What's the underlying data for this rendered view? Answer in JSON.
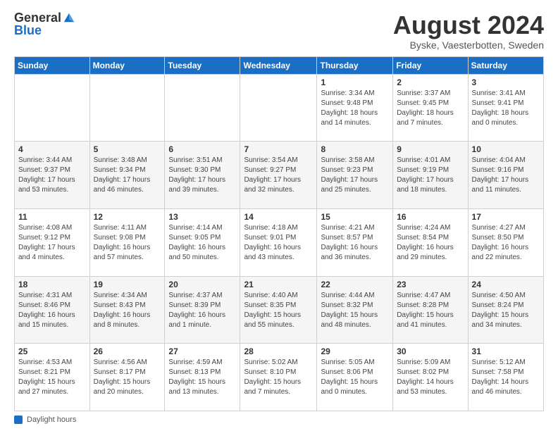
{
  "logo": {
    "general": "General",
    "blue": "Blue"
  },
  "title": "August 2024",
  "subtitle": "Byske, Vaesterbotten, Sweden",
  "days_of_week": [
    "Sunday",
    "Monday",
    "Tuesday",
    "Wednesday",
    "Thursday",
    "Friday",
    "Saturday"
  ],
  "footer": {
    "daylight_label": "Daylight hours"
  },
  "weeks": [
    [
      {
        "day": "",
        "info": ""
      },
      {
        "day": "",
        "info": ""
      },
      {
        "day": "",
        "info": ""
      },
      {
        "day": "",
        "info": ""
      },
      {
        "day": "1",
        "info": "Sunrise: 3:34 AM\nSunset: 9:48 PM\nDaylight: 18 hours\nand 14 minutes."
      },
      {
        "day": "2",
        "info": "Sunrise: 3:37 AM\nSunset: 9:45 PM\nDaylight: 18 hours\nand 7 minutes."
      },
      {
        "day": "3",
        "info": "Sunrise: 3:41 AM\nSunset: 9:41 PM\nDaylight: 18 hours\nand 0 minutes."
      }
    ],
    [
      {
        "day": "4",
        "info": "Sunrise: 3:44 AM\nSunset: 9:37 PM\nDaylight: 17 hours\nand 53 minutes."
      },
      {
        "day": "5",
        "info": "Sunrise: 3:48 AM\nSunset: 9:34 PM\nDaylight: 17 hours\nand 46 minutes."
      },
      {
        "day": "6",
        "info": "Sunrise: 3:51 AM\nSunset: 9:30 PM\nDaylight: 17 hours\nand 39 minutes."
      },
      {
        "day": "7",
        "info": "Sunrise: 3:54 AM\nSunset: 9:27 PM\nDaylight: 17 hours\nand 32 minutes."
      },
      {
        "day": "8",
        "info": "Sunrise: 3:58 AM\nSunset: 9:23 PM\nDaylight: 17 hours\nand 25 minutes."
      },
      {
        "day": "9",
        "info": "Sunrise: 4:01 AM\nSunset: 9:19 PM\nDaylight: 17 hours\nand 18 minutes."
      },
      {
        "day": "10",
        "info": "Sunrise: 4:04 AM\nSunset: 9:16 PM\nDaylight: 17 hours\nand 11 minutes."
      }
    ],
    [
      {
        "day": "11",
        "info": "Sunrise: 4:08 AM\nSunset: 9:12 PM\nDaylight: 17 hours\nand 4 minutes."
      },
      {
        "day": "12",
        "info": "Sunrise: 4:11 AM\nSunset: 9:08 PM\nDaylight: 16 hours\nand 57 minutes."
      },
      {
        "day": "13",
        "info": "Sunrise: 4:14 AM\nSunset: 9:05 PM\nDaylight: 16 hours\nand 50 minutes."
      },
      {
        "day": "14",
        "info": "Sunrise: 4:18 AM\nSunset: 9:01 PM\nDaylight: 16 hours\nand 43 minutes."
      },
      {
        "day": "15",
        "info": "Sunrise: 4:21 AM\nSunset: 8:57 PM\nDaylight: 16 hours\nand 36 minutes."
      },
      {
        "day": "16",
        "info": "Sunrise: 4:24 AM\nSunset: 8:54 PM\nDaylight: 16 hours\nand 29 minutes."
      },
      {
        "day": "17",
        "info": "Sunrise: 4:27 AM\nSunset: 8:50 PM\nDaylight: 16 hours\nand 22 minutes."
      }
    ],
    [
      {
        "day": "18",
        "info": "Sunrise: 4:31 AM\nSunset: 8:46 PM\nDaylight: 16 hours\nand 15 minutes."
      },
      {
        "day": "19",
        "info": "Sunrise: 4:34 AM\nSunset: 8:43 PM\nDaylight: 16 hours\nand 8 minutes."
      },
      {
        "day": "20",
        "info": "Sunrise: 4:37 AM\nSunset: 8:39 PM\nDaylight: 16 hours\nand 1 minute."
      },
      {
        "day": "21",
        "info": "Sunrise: 4:40 AM\nSunset: 8:35 PM\nDaylight: 15 hours\nand 55 minutes."
      },
      {
        "day": "22",
        "info": "Sunrise: 4:44 AM\nSunset: 8:32 PM\nDaylight: 15 hours\nand 48 minutes."
      },
      {
        "day": "23",
        "info": "Sunrise: 4:47 AM\nSunset: 8:28 PM\nDaylight: 15 hours\nand 41 minutes."
      },
      {
        "day": "24",
        "info": "Sunrise: 4:50 AM\nSunset: 8:24 PM\nDaylight: 15 hours\nand 34 minutes."
      }
    ],
    [
      {
        "day": "25",
        "info": "Sunrise: 4:53 AM\nSunset: 8:21 PM\nDaylight: 15 hours\nand 27 minutes."
      },
      {
        "day": "26",
        "info": "Sunrise: 4:56 AM\nSunset: 8:17 PM\nDaylight: 15 hours\nand 20 minutes."
      },
      {
        "day": "27",
        "info": "Sunrise: 4:59 AM\nSunset: 8:13 PM\nDaylight: 15 hours\nand 13 minutes."
      },
      {
        "day": "28",
        "info": "Sunrise: 5:02 AM\nSunset: 8:10 PM\nDaylight: 15 hours\nand 7 minutes."
      },
      {
        "day": "29",
        "info": "Sunrise: 5:05 AM\nSunset: 8:06 PM\nDaylight: 15 hours\nand 0 minutes."
      },
      {
        "day": "30",
        "info": "Sunrise: 5:09 AM\nSunset: 8:02 PM\nDaylight: 14 hours\nand 53 minutes."
      },
      {
        "day": "31",
        "info": "Sunrise: 5:12 AM\nSunset: 7:58 PM\nDaylight: 14 hours\nand 46 minutes."
      }
    ]
  ]
}
